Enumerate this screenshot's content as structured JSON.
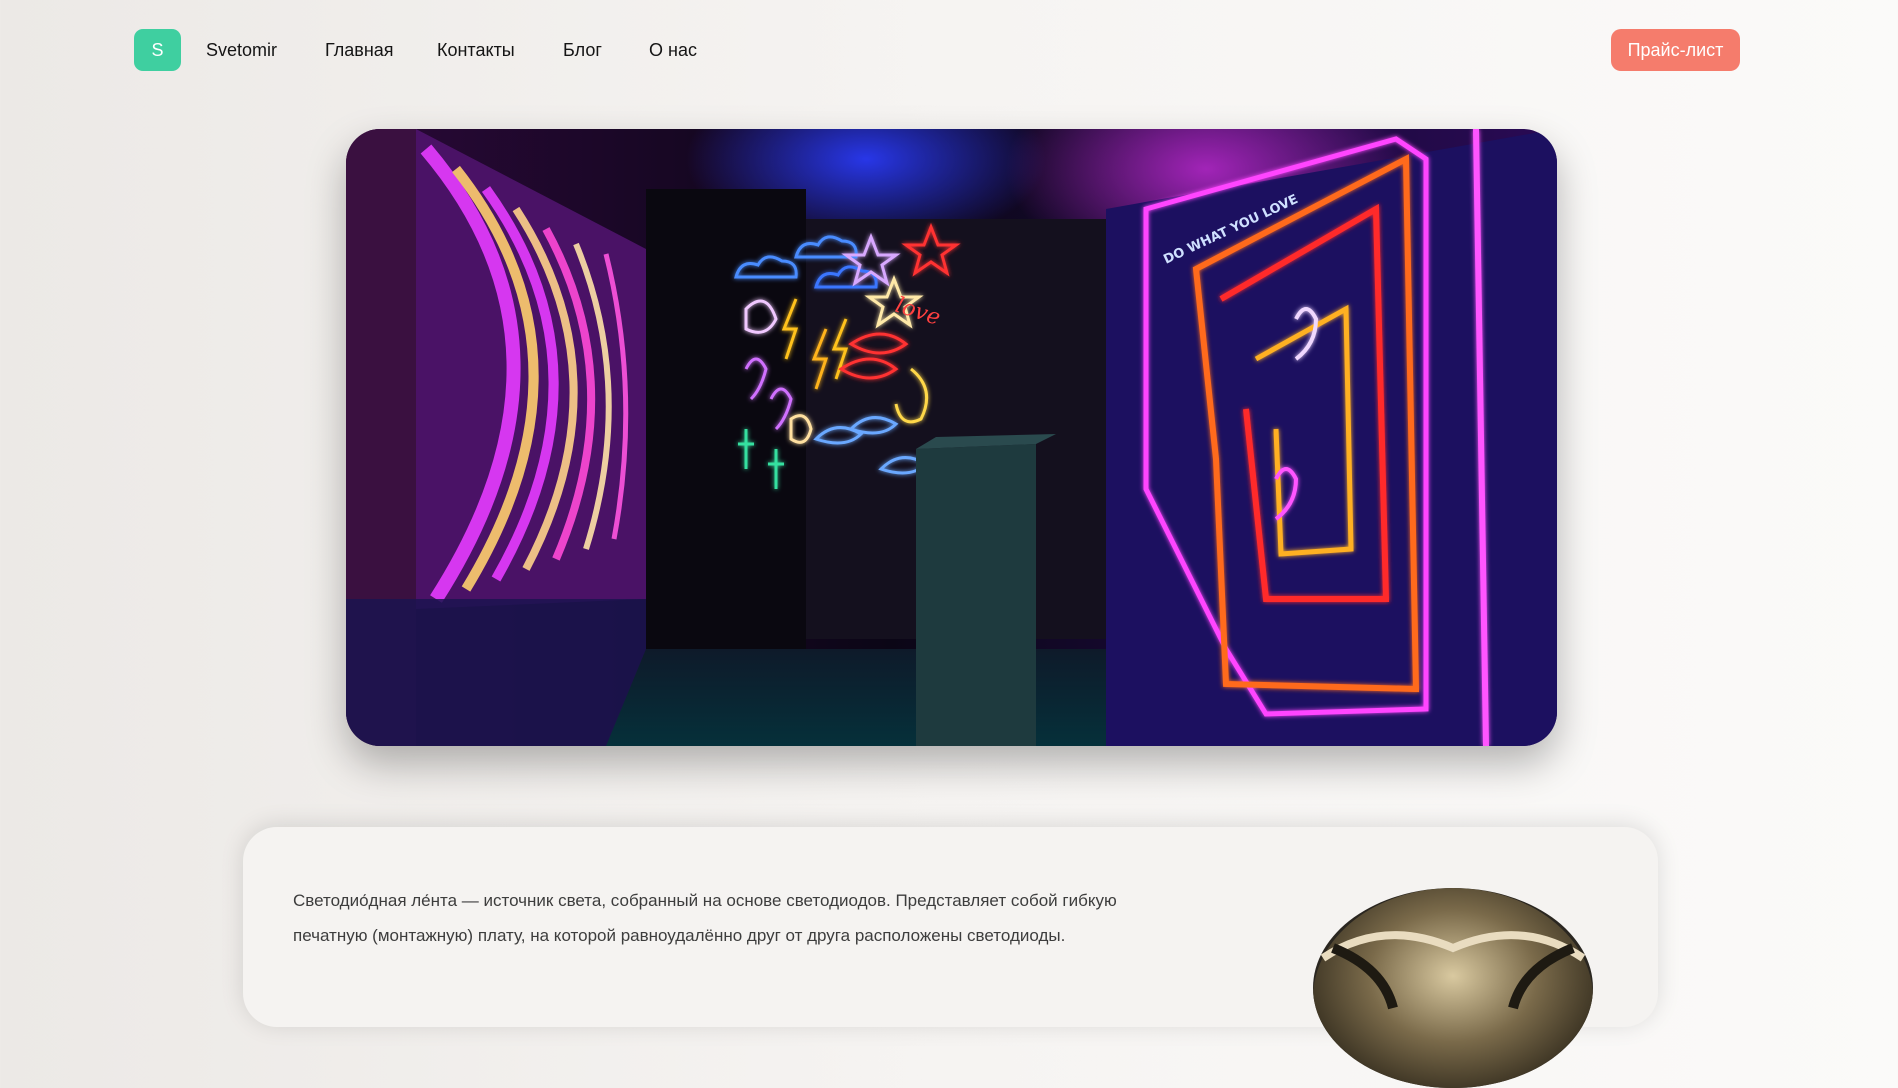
{
  "header": {
    "logo_letter": "S",
    "brand": "Svetomir",
    "nav": [
      "Главная",
      "Контакты",
      "Блог",
      "О нас"
    ],
    "cta_label": "Прайс-лист"
  },
  "hero": {
    "neon_sign_text": "DO WHAT YOU LOVE",
    "neon_word": "love"
  },
  "info": {
    "text_line_1": "Светодио́дная ле́нта — источник света, собранный на основе светодиодов. Представляет собой гибкую",
    "text_line_2": "печатную (монтажную) плату, на которой равноудалённо друг от друга расположены светодиоды."
  },
  "colors": {
    "logo_bg": "#3fcfa0",
    "cta_bg": "#f57c6c"
  }
}
